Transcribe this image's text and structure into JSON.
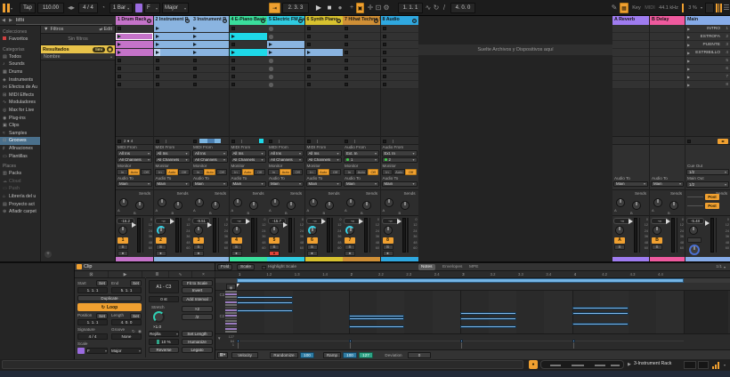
{
  "transport": {
    "tap": "Tap",
    "tempo": "110.00",
    "signature": "4 / 4",
    "quantization": "1 Bar",
    "scale_root": "F",
    "scale_name": "Major",
    "position": "2. 3. 3",
    "loop_start": "1. 1. 1",
    "loop_length": "4. 0. 0",
    "key_label": "Key",
    "midi_label": "MIDI",
    "sample_rate": "44.1 kHz",
    "cpu": "3 %"
  },
  "browser": {
    "search_value": "limi",
    "collections_title": "Colecciones",
    "favorites": "Favoritos",
    "categories_title": "Categorías",
    "categories": [
      {
        "icon": "▤",
        "label": "Todos"
      },
      {
        "icon": "♪",
        "label": "Sounds"
      },
      {
        "icon": "▦",
        "label": "Drums"
      },
      {
        "icon": "◈",
        "label": "Instruments"
      },
      {
        "icon": "⋈",
        "label": "Efectos de Au"
      },
      {
        "icon": "⊞",
        "label": "MIDI Effects"
      },
      {
        "icon": "∿",
        "label": "Moduladores"
      },
      {
        "icon": "◎",
        "label": "Max for Live"
      },
      {
        "icon": "◉",
        "label": "Plug-ins"
      },
      {
        "icon": "▣",
        "label": "Clips"
      },
      {
        "icon": "≈",
        "label": "Samples"
      },
      {
        "icon": "⊟",
        "label": "Grooves",
        "selected": true
      },
      {
        "icon": "♯",
        "label": "Afinaciones"
      },
      {
        "icon": "▭",
        "label": "Plantillas"
      }
    ],
    "places_title": "Places",
    "places": [
      {
        "icon": "▥",
        "label": "Packs"
      },
      {
        "icon": "☁",
        "label": "Cloud",
        "dim": true
      },
      {
        "icon": "▭",
        "label": "Push",
        "dim": true
      },
      {
        "icon": "⌂",
        "label": "Librería del u"
      },
      {
        "icon": "▤",
        "label": "Proyecto act"
      },
      {
        "icon": "⊕",
        "label": "Añadir carpet"
      }
    ],
    "filters_label": "Filtros",
    "edit_label": "Edit",
    "no_filters": "Sin filtros",
    "results_label": "Resultados",
    "results_badge": "limi",
    "name_column": "Nombre"
  },
  "session": {
    "drop_hint": "Suelte Archivos y Dispositivos aquí",
    "meter_scale": [
      "0",
      "12",
      "24",
      "36",
      "48",
      "60"
    ],
    "monitor_labels": [
      "In",
      "Auto",
      "Off"
    ],
    "monitor_label": "Monitor",
    "audio_to_label": "Audio To",
    "sends_label": "Sends",
    "tracks": [
      {
        "name": "1 Drum Rack",
        "color": "#c573c9",
        "clip_color": "#c573c9",
        "num": "1",
        "db": "-16.2",
        "from_label": "MIDI From",
        "from": "All Ins",
        "channel": "All Channels",
        "monitor_active": 1,
        "to": "Main",
        "slots": [
          "stop",
          "play",
          "clip",
          "clip",
          "stop",
          "stop",
          "stop",
          "stop"
        ],
        "status_type": "counter",
        "status_text": "2 ● 4",
        "pan_arc": false,
        "armed": false
      },
      {
        "name": "2 Instrument R",
        "color": "#8ab4e0",
        "clip_color": "#8ab4e0",
        "num": "2",
        "db": "-∞",
        "from_label": "MIDI From",
        "from": "All Ins",
        "channel": "All Channels",
        "monitor_active": 1,
        "to": "Main",
        "slots": [
          "clip",
          "clip",
          "clip",
          "sel",
          "stop",
          "stop",
          "stop",
          "stop"
        ],
        "status_type": "line",
        "status_text": "",
        "pan_arc": true,
        "armed": false
      },
      {
        "name": "3 Instrument R",
        "color": "#8ab4e0",
        "clip_color": "#8ab4e0",
        "num": "3",
        "db": "-9.51",
        "from_label": "MIDI From",
        "from": "All Ins",
        "channel": "All Channels",
        "monitor_active": 1,
        "to": "Main",
        "slots": [
          "clip",
          "clip",
          "clip",
          "clip",
          "stop",
          "stop",
          "stop",
          "stop"
        ],
        "status_type": "bar",
        "status_text": "",
        "pan_arc": false,
        "armed": false
      },
      {
        "name": "4 E-Piano Basic",
        "color": "#3adf9c",
        "clip_color": "#1ed9e8",
        "num": "4",
        "db": "-∞",
        "from_label": "MIDI From",
        "from": "All Ins",
        "channel": "All Channels",
        "monitor_active": 1,
        "to": "Main",
        "slots": [
          "stop",
          "cclip",
          "stop",
          "cclip",
          "stop",
          "stop",
          "stop",
          "stop"
        ],
        "status_type": "linecyan",
        "status_text": "",
        "pan_arc": false,
        "armed": false
      },
      {
        "name": "5 Electric FM Fuz",
        "color": "#2fcbe0",
        "clip_color": "#8ab4e0",
        "num": "5",
        "db": "-15.7",
        "from_label": "MIDI From",
        "from": "All Ins",
        "channel": "All Channels",
        "monitor_active": 1,
        "to": "Main",
        "slots": [
          "rec",
          "rec",
          "clip",
          "clip",
          "rec",
          "rec",
          "rec",
          "rec"
        ],
        "status_type": "line",
        "status_text": "",
        "pan_arc": false,
        "armed": true
      },
      {
        "name": "6 Synth Piano",
        "color": "#d8c22f",
        "clip_color": "#8ab4e0",
        "num": "6",
        "db": "-∞",
        "from_label": "MIDI From",
        "from": "All Ins",
        "channel": "All Channels",
        "monitor_active": 1,
        "to": "Main",
        "slots": [
          "stop",
          "stop",
          "stop",
          "clip",
          "stop",
          "stop",
          "stop",
          "stop"
        ],
        "status_type": "line",
        "status_text": "",
        "pan_arc": true,
        "armed": false
      },
      {
        "name": "7 Hihat Techno St",
        "color": "#cf8f36",
        "clip_color": "#cf8f36",
        "num": "7",
        "db": "-∞",
        "from_label": "Audio From",
        "from": "Ext. In",
        "channel": "1",
        "monitor_active": 2,
        "to": "Main",
        "slots": [
          "stop",
          "stop",
          "stop",
          "stop",
          "stop",
          "stop",
          "stop",
          "stop"
        ],
        "status_type": "line",
        "status_text": "",
        "pan_arc": true,
        "armed": false
      },
      {
        "name": "8 Audio",
        "color": "#2fa8e0",
        "clip_color": "#2fa8e0",
        "num": "8",
        "db": "-∞",
        "from_label": "Audio From",
        "from": "Ext. In",
        "channel": "2",
        "monitor_active": 2,
        "to": "Main",
        "slots": [
          "stop",
          "stop",
          "stop",
          "stop",
          "stop",
          "stop",
          "stop",
          "stop"
        ],
        "status_type": "line",
        "status_text": "",
        "pan_arc": false,
        "armed": false
      }
    ],
    "returns": [
      {
        "name": "A Reverb",
        "color": "#9f7cf0",
        "num": "A",
        "db": "-∞"
      },
      {
        "name": "B Delay",
        "color": "#ef5a9e",
        "num": "B",
        "db": "-∞"
      }
    ],
    "main": {
      "name": "Main",
      "color": "#86abe8",
      "db": "-5.48",
      "cue_out_label": "Cue Out",
      "cue_out": "1/2",
      "main_out_label": "Main Out",
      "main_out": "1/2",
      "post_label": "Post"
    },
    "scenes": [
      {
        "name": "INTRO",
        "num": "1"
      },
      {
        "name": "ESTROFA",
        "num": "2"
      },
      {
        "name": "PUENTE",
        "num": "3"
      },
      {
        "name": "ESTRIBILLO",
        "num": "4"
      },
      {
        "name": "",
        "num": "5"
      },
      {
        "name": "",
        "num": "6"
      },
      {
        "name": "",
        "num": "7"
      },
      {
        "name": "",
        "num": "8"
      }
    ]
  },
  "clip_panel": {
    "title": "Clip",
    "start_label": "Start",
    "end_label": "End",
    "set_label": "Set",
    "start": "1. 1. 1",
    "end": "5. 1. 1",
    "duplicate": "Duplicate",
    "loop": "Loop",
    "position_label": "Position",
    "length_label": "Length",
    "position": "1. 1. 1",
    "length": "4. 0. 0",
    "signature_label": "Signature",
    "groove_label": "Groove",
    "signature": "4 / 4",
    "groove": "None",
    "scale_label": "Scale",
    "scale_root": "F",
    "scale_name": "Major",
    "pitch_range": "A1 - C3",
    "fit_to_scale": "Fit to Scale",
    "invert": "Invert",
    "transpose": "0 st",
    "add_interval": "Add Interval",
    "stretch_label": "Stretch",
    "stretch_value": "×1.0",
    "mult2": "×2",
    "div2": "/2",
    "grid_label": "Rejilla",
    "set_length": "Set Length",
    "chance": "10 %",
    "humanize": "Humanize",
    "reverse": "Reverse",
    "legato": "Legato"
  },
  "midi_editor": {
    "fold": "Fold",
    "scale": "Scale",
    "highlight_scale": "Highlight Scale",
    "tabs": [
      "Notes",
      "Envelopes",
      "MPE"
    ],
    "zoom_level": "1/1",
    "ruler": [
      "1",
      "1.2",
      "1.3",
      "1.4",
      "2",
      "2.2",
      "2.3",
      "2.4",
      "3",
      "3.2",
      "3.3",
      "3.4",
      "4",
      "4.2",
      "4.3",
      "4.4"
    ],
    "key_labels": [
      {
        "label": "C3",
        "row": 1
      },
      {
        "label": "C2",
        "row": 9
      }
    ],
    "key_rows": [
      "w",
      "p",
      "w",
      "b",
      "p",
      "w",
      "b",
      "p",
      "w",
      "p",
      "b",
      "w",
      "p",
      "b",
      "p",
      "w"
    ],
    "velocity_scale": [
      "127",
      "64",
      "1"
    ],
    "chart_data": {
      "type": "piano-roll",
      "bars": 4,
      "notes": [
        {
          "bar": 1,
          "row": 2,
          "len": 0.5
        },
        {
          "bar": 1,
          "row": 4,
          "len": 0.5
        },
        {
          "bar": 1,
          "row": 7,
          "len": 0.5
        },
        {
          "bar": 2,
          "row": 9,
          "len": 0.5
        },
        {
          "bar": 2,
          "row": 10,
          "len": 0.5
        },
        {
          "bar": 2,
          "row": 13,
          "len": 0.5
        },
        {
          "bar": 3,
          "row": 8,
          "len": 0.5
        },
        {
          "bar": 3,
          "row": 10,
          "len": 0.5
        },
        {
          "bar": 3,
          "row": 13,
          "len": 0.5
        },
        {
          "bar": 4,
          "row": 6,
          "len": 0.5
        },
        {
          "bar": 4,
          "row": 8,
          "len": 0.5
        },
        {
          "bar": 4,
          "row": 12,
          "len": 0.5
        }
      ],
      "velocity_markers": [
        1,
        2,
        3,
        4
      ]
    },
    "velocity_controls": {
      "label": "Velocity",
      "randomize": "Randomize",
      "randomize_value": "100",
      "ramp": "Ramp",
      "ramp_from": "100",
      "ramp_to": "127",
      "deviation": "Deviation",
      "deviation_value": "0"
    }
  },
  "status_bar": {
    "device_name": "3-Instrument Rack"
  }
}
